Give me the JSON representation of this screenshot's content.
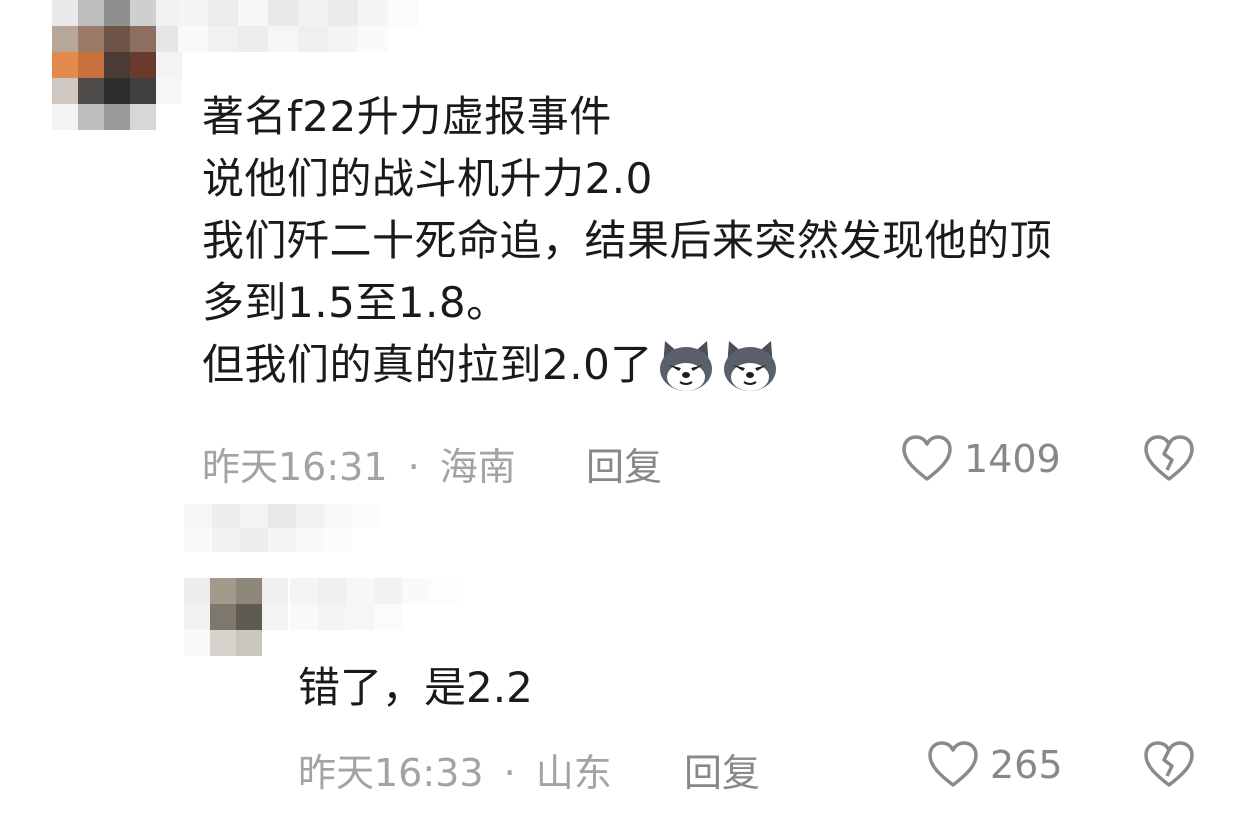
{
  "comment1": {
    "lines": [
      "著名f22升力虚报事件",
      "说他们的战斗机升力2.0",
      "我们歼二十死命追，结果后来突然发现他的顶",
      "多到1.5至1.8。",
      "但我们的真的拉到2.0了"
    ],
    "emoji_icon": "husky-dog-emoji",
    "time": "昨天16:31",
    "separator": "·",
    "location": "海南",
    "reply_label": "回复",
    "likes": "1409"
  },
  "comment2": {
    "text": "错了，是2.2",
    "time": "昨天16:33",
    "separator": "·",
    "location": "山东",
    "reply_label": "回复",
    "likes": "265"
  },
  "colors": {
    "text": "#1a1a1a",
    "meta": "#a3a3a3",
    "icon": "#8a8a8a"
  }
}
